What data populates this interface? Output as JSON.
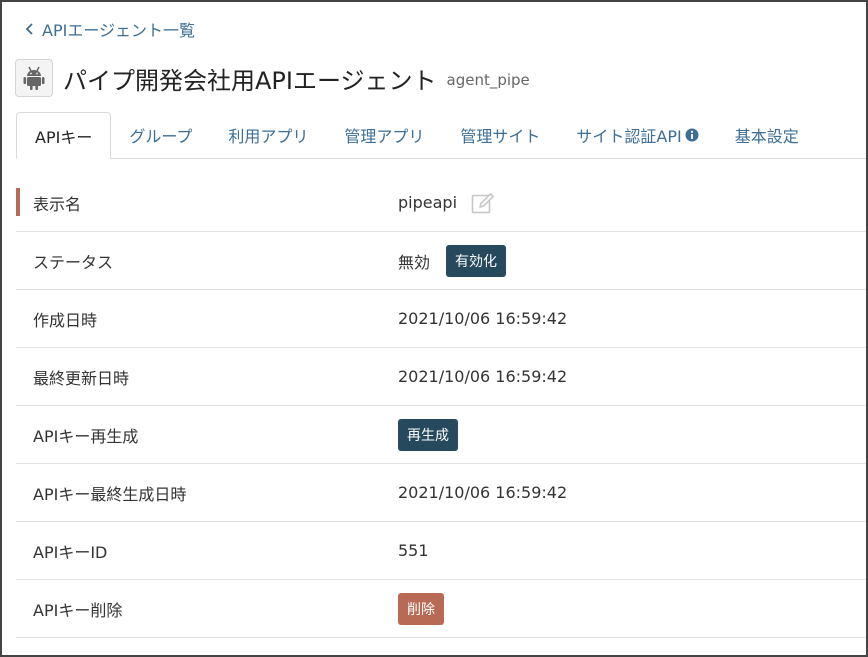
{
  "nav": {
    "back_label": "APIエージェント一覧"
  },
  "header": {
    "title": "パイプ開発会社用APIエージェント",
    "agent_id": "agent_pipe",
    "icon": "android-icon"
  },
  "tabs": [
    {
      "label": "APIキー",
      "active": true
    },
    {
      "label": "グループ"
    },
    {
      "label": "利用アプリ"
    },
    {
      "label": "管理アプリ"
    },
    {
      "label": "管理サイト"
    },
    {
      "label": "サイト認証API"
    },
    {
      "label": "基本設定"
    }
  ],
  "details": {
    "display_name": {
      "label": "表示名",
      "value": "pipeapi"
    },
    "status": {
      "label": "ステータス",
      "value": "無効",
      "button": "有効化"
    },
    "created": {
      "label": "作成日時",
      "value": "2021/10/06 16:59:42"
    },
    "updated": {
      "label": "最終更新日時",
      "value": "2021/10/06 16:59:42"
    },
    "regenerate": {
      "label": "APIキー再生成",
      "button": "再生成"
    },
    "last_generated": {
      "label": "APIキー最終生成日時",
      "value": "2021/10/06 16:59:42"
    },
    "key_id": {
      "label": "APIキーID",
      "value": "551"
    },
    "delete": {
      "label": "APIキー削除",
      "button": "削除"
    }
  },
  "colors": {
    "link": "#3c6e96",
    "dark_button": "#26495e",
    "danger_button": "#b96a55",
    "active_marker": "#b96a55"
  }
}
